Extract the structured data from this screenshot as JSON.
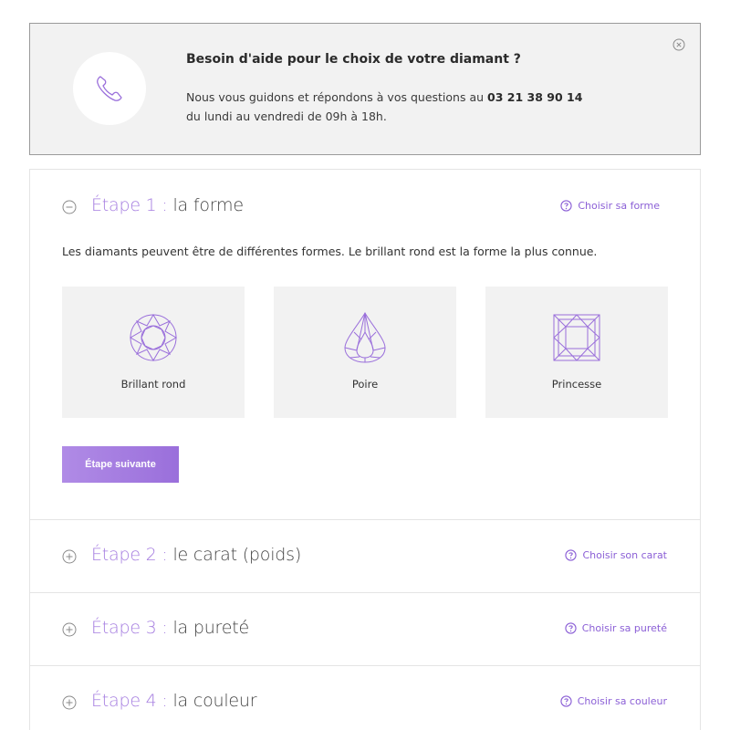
{
  "help": {
    "title": "Besoin d'aide pour le choix de votre diamant ?",
    "line1_prefix": "Nous vous guidons et répondons à vos questions au ",
    "phone": "03 21 38 90 14",
    "line2": "du lundi au vendredi de 09h à 18h."
  },
  "steps": [
    {
      "number": "Étape 1",
      "separator": " : ",
      "name": "la forme",
      "link": "Choisir sa forme",
      "expanded": true,
      "description": "Les diamants peuvent être de différentes formes. Le brillant rond est la forme la plus connue.",
      "shapes": [
        {
          "label": "Brillant rond",
          "icon": "round-brilliant-icon"
        },
        {
          "label": "Poire",
          "icon": "pear-diamond-icon"
        },
        {
          "label": "Princesse",
          "icon": "princess-diamond-icon"
        }
      ],
      "next_button": "Étape suivante"
    },
    {
      "number": "Étape 2",
      "separator": " : ",
      "name": "le carat (poids)",
      "link": "Choisir son carat",
      "expanded": false
    },
    {
      "number": "Étape 3",
      "separator": " : ",
      "name": "la pureté",
      "link": "Choisir sa pureté",
      "expanded": false
    },
    {
      "number": "Étape 4",
      "separator": " : ",
      "name": "la couleur",
      "link": "Choisir sa couleur",
      "expanded": false
    }
  ],
  "colors": {
    "accent": "#a67ee0",
    "link": "#8b5fd6",
    "banner_bg": "#f2f2f2",
    "card_bg": "#f2f2f2",
    "button_start": "#b08be6",
    "button_end": "#9a6fdb"
  }
}
